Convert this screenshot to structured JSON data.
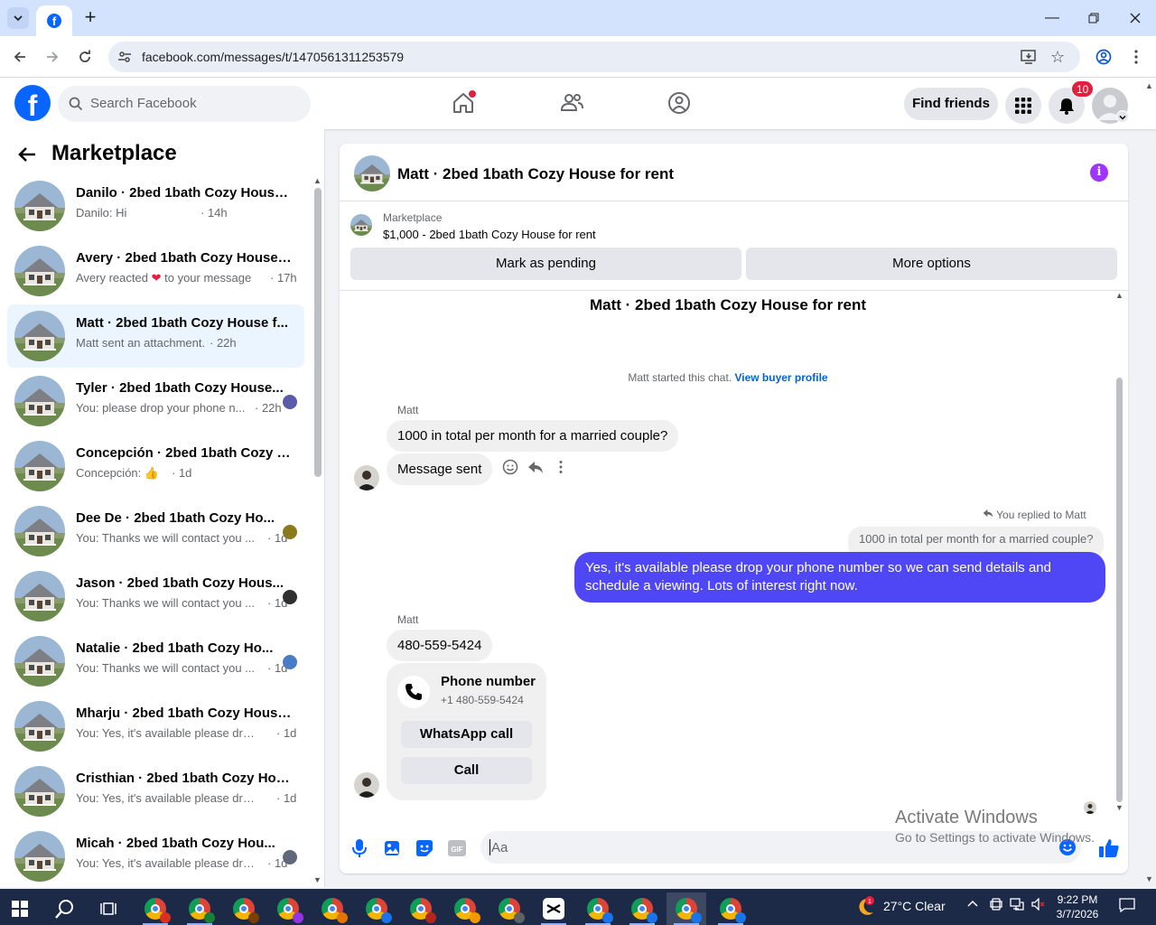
{
  "browser": {
    "url": "facebook.com/messages/t/1470561311253579",
    "tab_icon": "facebook-icon"
  },
  "header": {
    "search_placeholder": "Search Facebook",
    "find_friends": "Find friends",
    "notification_count": "10"
  },
  "sidebar": {
    "title": "Marketplace",
    "conversations": [
      {
        "name": "Danilo · 2bed 1bath Cozy House ...",
        "preview": "Danilo: Hi",
        "time": "· 14h"
      },
      {
        "name": "Avery · 2bed 1bath Cozy House f...",
        "preview": "Avery reacted",
        "preview2": "to your message",
        "time": "· 17h"
      },
      {
        "name": "Matt · 2bed 1bath Cozy House f...",
        "preview": "Matt sent an attachment.",
        "time": "· 22h"
      },
      {
        "name": "Tyler · 2bed 1bath Cozy House...",
        "preview": "You: please drop your phone n...",
        "time": "· 22h"
      },
      {
        "name": "Concepción · 2bed 1bath Cozy H...",
        "preview": "Concepción:",
        "time": "· 1d"
      },
      {
        "name": "Dee De · 2bed 1bath Cozy Ho...",
        "preview": "You: Thanks we will contact you ...",
        "time": "· 1d"
      },
      {
        "name": "Jason · 2bed 1bath Cozy Hous...",
        "preview": "You: Thanks we will contact you ...",
        "time": "· 1d"
      },
      {
        "name": "Natalie · 2bed 1bath Cozy Ho...",
        "preview": "You: Thanks we will contact you ...",
        "time": "· 1d"
      },
      {
        "name": "Mharju · 2bed 1bath Cozy House...",
        "preview": "You: Yes, it's available please drop y...",
        "time": "· 1d"
      },
      {
        "name": "Cristhian · 2bed 1bath Cozy Hou...",
        "preview": "You: Yes, it's available please drop y...",
        "time": "· 1d"
      },
      {
        "name": "Micah · 2bed 1bath Cozy Hou...",
        "preview": "You: Yes, it's available please dro...",
        "time": "· 1d"
      }
    ]
  },
  "chat": {
    "title": "Matt · 2bed 1bath Cozy House for rent",
    "marketplace_label": "Marketplace",
    "listing": "$1,000 - 2bed 1bath Cozy House for rent",
    "mark_pending": "Mark as pending",
    "more_options": "More options",
    "conversation_title": "Matt · 2bed 1bath Cozy House for rent",
    "started_text": "Matt started this chat.",
    "view_buyer_profile": "View buyer profile",
    "sender1": "Matt",
    "msg1": "1000 in total per month for a married couple?",
    "msg2": "Message sent",
    "replied_to": "You replied to Matt",
    "quoted": "1000 in total per month for a married couple?",
    "reply_line1": "Yes, it's available please drop your phone number so we can send details and",
    "reply_line2": "schedule a viewing. Lots of interest right now.",
    "sender2": "Matt",
    "msg3": "480-559-5424",
    "phone_label": "Phone number",
    "phone_number": "+1 480-559-5424",
    "whatsapp": "WhatsApp call",
    "call": "Call",
    "composer_placeholder": "Aa"
  },
  "watermark": {
    "line1": "Activate Windows",
    "line2": "Go to Settings to activate Windows."
  },
  "taskbar": {
    "weather": "27°C  Clear",
    "time": "9:22 PM",
    "date": "3/7/2026"
  },
  "colors": {
    "fb_blue": "#0866ff",
    "outgoing_bubble": "#4f46f5",
    "active_conversation": "#ebf5ff",
    "notification_red": "#e41e3f"
  }
}
